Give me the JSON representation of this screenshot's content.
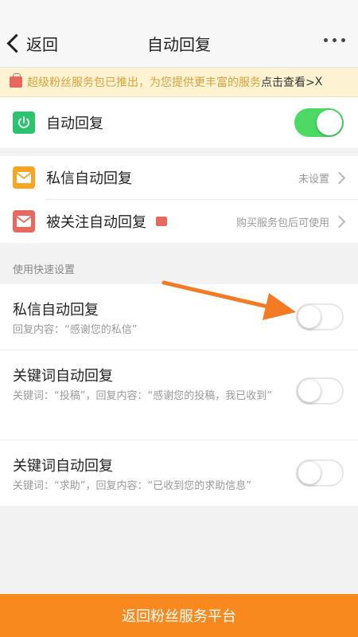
{
  "nav": {
    "back_label": "返回",
    "title": "自动回复"
  },
  "banner": {
    "text": "超级粉丝服务包已推出，为您提供更丰富的服务",
    "link": "点击查看>",
    "close": "X"
  },
  "master_toggle": {
    "label": "自动回复",
    "on": true,
    "color": "#4cd964"
  },
  "menu": [
    {
      "label": "私信自动回复",
      "value": "未设置",
      "icon": "mail-edit-icon",
      "icon_color": "#f5a623"
    },
    {
      "label": "被关注自动回复",
      "value": "购买服务包后可使用",
      "icon": "mail-icon",
      "icon_color": "#e7685d",
      "badge_icon": "bag-icon"
    }
  ],
  "section_title": "使用快速设置",
  "quick_settings": [
    {
      "title": "私信自动回复",
      "desc": "回复内容：“感谢您的私信”",
      "on": false
    },
    {
      "title": "关键词自动回复",
      "desc": "关键词：“投稿”，回复内容：“感谢您的投稿，我已收到”",
      "on": false
    },
    {
      "title": "关键词自动回复",
      "desc": "关键词：“求助”，回复内容：“已收到您的求助信息”",
      "on": false
    }
  ],
  "footer": {
    "label": "返回粉丝服务平台",
    "color": "#f7891f"
  },
  "annotation": {
    "arrow_color": "#f47a23"
  }
}
